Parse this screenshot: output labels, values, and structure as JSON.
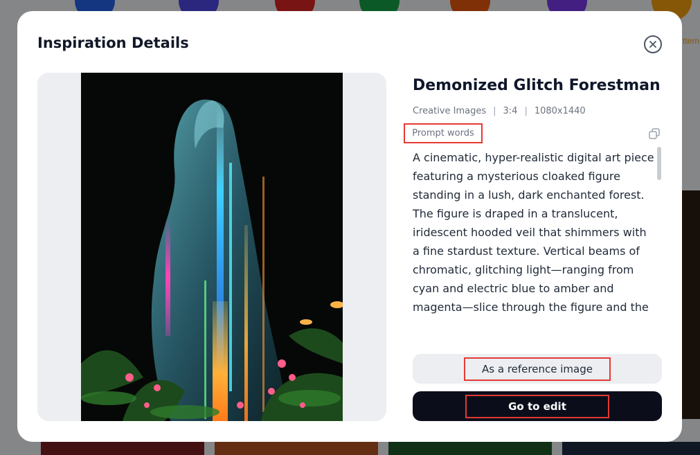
{
  "background": {
    "partial_label": "ttern",
    "icon_colors": [
      "#2563eb",
      "#4f46e5",
      "#dc2626",
      "#16a34a",
      "#ea580c",
      "#7c3aed",
      "#f59e0b"
    ]
  },
  "modal": {
    "title": "Inspiration Details",
    "close_icon": "close-circle-icon"
  },
  "detail": {
    "title": "Demonized Glitch Forestman",
    "category": "Creative Images",
    "separator": "|",
    "ratio": "3:4",
    "resolution": "1080x1440",
    "prompt_label": "Prompt words",
    "copy_icon": "copy-icon",
    "prompt_text": "A cinematic, hyper-realistic digital art piece featuring a mysterious cloaked figure standing in a lush, dark enchanted forest. The figure is draped in a translucent, iridescent hooded veil that shimmers with a fine stardust texture. Vertical beams of chromatic, glitching light—ranging from cyan and electric blue to amber and magenta—slice through the figure and the"
  },
  "actions": {
    "reference_label": "As a reference image",
    "edit_label": "Go to edit"
  },
  "colors": {
    "accent_dark": "#0b0e1a",
    "highlight_box": "#e53935"
  }
}
